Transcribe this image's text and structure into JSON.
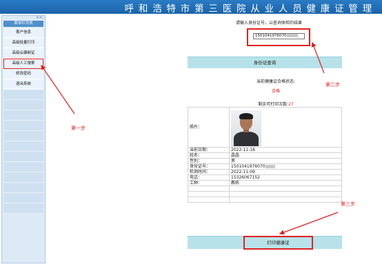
{
  "header": {
    "title": "呼和浩特市第三医院从业人员健康证管理"
  },
  "sidebar": {
    "collapse": "<<",
    "heading": "菜单栏列表",
    "items": [
      {
        "label": "客户信息"
      },
      {
        "label": "高级批量打印"
      },
      {
        "label": "高级云编制证"
      },
      {
        "label": "高级人工搜索"
      },
      {
        "label": "修改密码"
      },
      {
        "label": "退出系统"
      }
    ]
  },
  "search": {
    "prompt": "请输入身份证号，以查询体检的结果",
    "id_value": "1501041976070"
  },
  "query_button": "身份证查询",
  "status": {
    "label": "当前健康证合格状态:",
    "value": "合格",
    "remain_label": "剩余可打印次数:",
    "remain_count": "27"
  },
  "record": {
    "photo_label": "照片：",
    "rows": [
      {
        "key": "当前日期：",
        "value": "2022-11-18"
      },
      {
        "key": "姓名：",
        "value": "晶晶"
      },
      {
        "key": "性别：",
        "value": "男"
      },
      {
        "key": "身份证号：",
        "value": "1501041976070"
      },
      {
        "key": "检测时间：",
        "value": "2022-11-09"
      },
      {
        "key": "电话：",
        "value": "15326067152"
      },
      {
        "key": "工种：",
        "value": "教练"
      }
    ]
  },
  "print_button": "打印健康证",
  "annotations": {
    "step1": "第一步",
    "step2": "第二步",
    "step3": "第三步"
  },
  "colors": {
    "accent": "#e02020",
    "header": "#1f6fb8",
    "bar": "#b7e2e9"
  }
}
